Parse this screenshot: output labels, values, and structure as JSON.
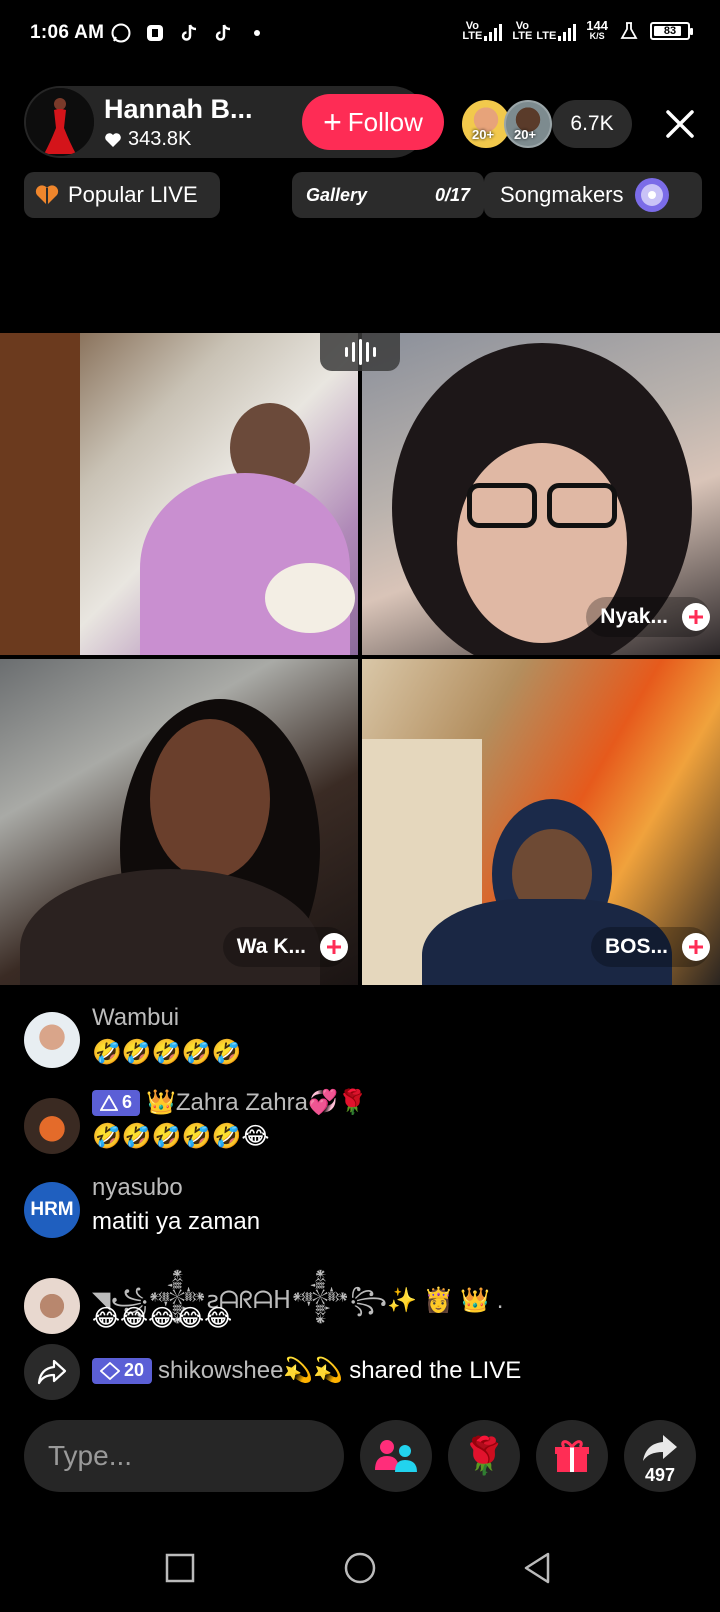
{
  "status_bar": {
    "time": "1:06 AM",
    "net1_label_top": "Vo",
    "net1_label_bottom": "LTE",
    "net2_label_top": "Vo",
    "net2_label_bottom": "LTE",
    "net3_label": "LTE",
    "speed_value": "144",
    "speed_unit": "K/S",
    "battery": "83",
    "battery_level": 0.83
  },
  "host": {
    "name": "Hannah B...",
    "likes": "343.8K",
    "follow_label": "Follow"
  },
  "viewers": {
    "badge_1": "20+",
    "badge_2": "20+",
    "count": "6.7K"
  },
  "tags": {
    "popular": "Popular LIVE",
    "gallery": "Gallery",
    "gallery_progress": "0/17",
    "songmakers": "Songmakers"
  },
  "guests": [
    {
      "name": ""
    },
    {
      "name": "Nyak..."
    },
    {
      "name": "Wa K..."
    },
    {
      "name": "BOS..."
    }
  ],
  "comments": [
    {
      "user": "Wambui",
      "text": "🤣🤣🤣🤣🤣"
    },
    {
      "badge_level": "6",
      "user": "👑Zahra Zahra💞🌹",
      "text": "🤣🤣🤣🤣🤣😂"
    },
    {
      "avatar_text": "HRM",
      "user": "nyasubo",
      "text": "matiti ya zaman"
    },
    {
      "user": "◥꧁𒀱ꙅᗩᖇᗩᕼ𒀱꧂✨ 👸 👑 .",
      "text": "😂😂😂😂😂"
    }
  ],
  "share_event": {
    "badge_level": "20",
    "user": "shikowshee💫💫",
    "text": "shared the LIVE"
  },
  "bottom_bar": {
    "input_placeholder": "Type...",
    "rose_glyph": "🌹",
    "share_count": "497"
  },
  "colors": {
    "accent": "#fe2c55",
    "badge": "#5b5fd6",
    "pill_bg": "#262626"
  }
}
